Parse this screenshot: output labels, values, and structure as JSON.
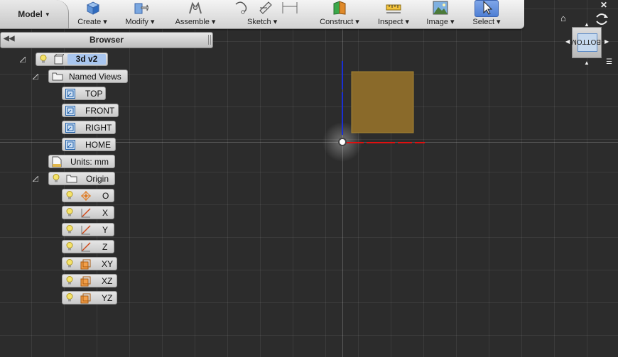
{
  "toolbar": {
    "model_label": "Model",
    "groups": [
      {
        "label": "Create"
      },
      {
        "label": "Modify"
      },
      {
        "label": "Assemble"
      },
      {
        "label": "Sketch"
      },
      {
        "label": "Construct"
      },
      {
        "label": "Inspect"
      },
      {
        "label": "Image"
      },
      {
        "label": "Select"
      }
    ]
  },
  "browser": {
    "title": "Browser",
    "root": {
      "name": "3d v2"
    },
    "named_views": {
      "label": "Named Views",
      "items": [
        {
          "label": "TOP"
        },
        {
          "label": "FRONT"
        },
        {
          "label": "RIGHT"
        },
        {
          "label": "HOME"
        }
      ]
    },
    "units": {
      "label": "Units: mm"
    },
    "origin": {
      "label": "Origin",
      "items": [
        {
          "label": "O",
          "icon": "origin-point-icon"
        },
        {
          "label": "X",
          "icon": "axis-icon"
        },
        {
          "label": "Y",
          "icon": "axis-icon"
        },
        {
          "label": "Z",
          "icon": "axis-icon"
        },
        {
          "label": "XY",
          "icon": "plane-icon"
        },
        {
          "label": "XZ",
          "icon": "plane-icon"
        },
        {
          "label": "YZ",
          "icon": "plane-icon"
        }
      ]
    }
  },
  "viewcube": {
    "face_label": "BOTTOM"
  },
  "colors": {
    "viewport_bg": "#2c2c2c",
    "sketch_fill": "#8a6a2a",
    "x_axis": "#e01010",
    "y_axis": "#1a2fd6",
    "selection": "#a9c6ef"
  }
}
